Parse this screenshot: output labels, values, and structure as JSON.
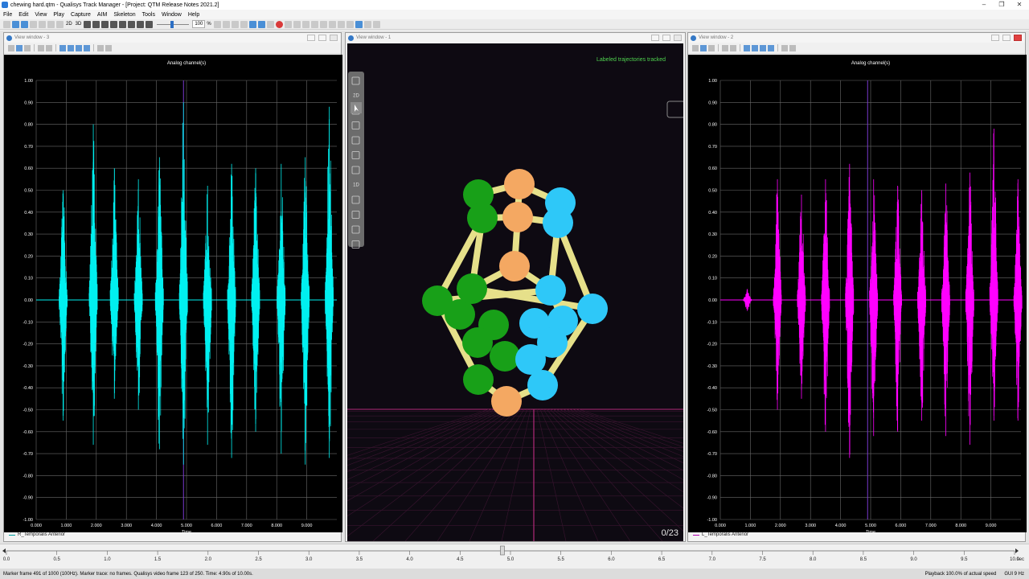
{
  "window": {
    "title": "chewing hard.qtm - Qualisys Track Manager - [Project: QTM Release Notes 2021.2]",
    "controls": [
      "–",
      "❐",
      "✕"
    ]
  },
  "menu": [
    "File",
    "Edit",
    "View",
    "Play",
    "Capture",
    "AIM",
    "Skeleton",
    "Tools",
    "Window",
    "Help"
  ],
  "toolbar": {
    "mode_2d": "2D",
    "mode_3d": "3D",
    "speed_value": "100",
    "speed_unit": "%"
  },
  "windows": {
    "left": {
      "title": "View window - 3",
      "plot_title": "Analog channel(s)",
      "xlabel": "Time",
      "legend": "R_Temporalis Anterior",
      "color": "#00f0f0"
    },
    "middle": {
      "title": "View window - 1",
      "status": "Labeled trajectories tracked",
      "counter": "0/23",
      "tools": [
        "2D",
        "1D"
      ]
    },
    "right": {
      "title": "View window - 2",
      "plot_title": "Analog channel(s)",
      "xlabel": "Time",
      "legend": "L_Temporalis Anterior",
      "color": "#ff00ff"
    }
  },
  "chart_data": [
    {
      "type": "line",
      "title": "Analog channel(s)",
      "xlabel": "Time",
      "ylabel": "",
      "xlim": [
        0,
        10
      ],
      "ylim": [
        -1,
        1
      ],
      "xticks": [
        "0.000",
        "1.000",
        "2.000",
        "3.000",
        "4.000",
        "5.000",
        "6.000",
        "7.000",
        "8.000",
        "9.000"
      ],
      "yticks": [
        "1.00",
        "0.90",
        "0.80",
        "0.70",
        "0.60",
        "0.50",
        "0.40",
        "0.30",
        "0.20",
        "0.10",
        "0.00",
        "-0.10",
        "-0.20",
        "-0.30",
        "-0.40",
        "-0.50",
        "-0.60",
        "-0.70",
        "-0.80",
        "-0.90",
        "-1.00"
      ],
      "grid": true,
      "series": [
        {
          "name": "R_Temporalis Anterior",
          "color": "#00f0f0",
          "bursts": [
            {
              "t": 0.9,
              "max": 0.5,
              "min": -0.55
            },
            {
              "t": 1.9,
              "max": 0.8,
              "min": -0.66
            },
            {
              "t": 2.6,
              "max": 0.6,
              "min": -0.45
            },
            {
              "t": 3.4,
              "max": 0.55,
              "min": -0.5
            },
            {
              "t": 4.1,
              "max": 0.65,
              "min": -0.68
            },
            {
              "t": 4.9,
              "max": 0.9,
              "min": -0.75
            },
            {
              "t": 5.7,
              "max": 0.52,
              "min": -0.66
            },
            {
              "t": 6.5,
              "max": 0.62,
              "min": -0.72
            },
            {
              "t": 7.3,
              "max": 0.6,
              "min": -0.6
            },
            {
              "t": 8.15,
              "max": 0.62,
              "min": -0.7
            },
            {
              "t": 8.95,
              "max": 0.65,
              "min": -0.75
            },
            {
              "t": 9.75,
              "max": 0.88,
              "min": -0.72
            }
          ]
        }
      ]
    },
    {
      "type": "line",
      "title": "Analog channel(s)",
      "xlabel": "Time",
      "ylabel": "",
      "xlim": [
        0,
        10
      ],
      "ylim": [
        -1,
        1
      ],
      "xticks": [
        "0.000",
        "1.000",
        "2.000",
        "3.000",
        "4.000",
        "5.000",
        "6.000",
        "7.000",
        "8.000",
        "9.000"
      ],
      "yticks": [
        "1.00",
        "0.90",
        "0.80",
        "0.70",
        "0.60",
        "0.50",
        "0.40",
        "0.30",
        "0.20",
        "0.10",
        "0.00",
        "-0.10",
        "-0.20",
        "-0.30",
        "-0.40",
        "-0.50",
        "-0.60",
        "-0.70",
        "-0.80",
        "-0.90",
        "-1.00"
      ],
      "grid": true,
      "series": [
        {
          "name": "L_Temporalis Anterior",
          "color": "#ff00ff",
          "bursts": [
            {
              "t": 0.9,
              "max": 0.05,
              "min": -0.05
            },
            {
              "t": 1.9,
              "max": 0.55,
              "min": -0.5
            },
            {
              "t": 2.7,
              "max": 0.48,
              "min": -0.45
            },
            {
              "t": 3.5,
              "max": 0.55,
              "min": -0.6
            },
            {
              "t": 4.3,
              "max": 0.62,
              "min": -0.72
            },
            {
              "t": 5.1,
              "max": 0.55,
              "min": -0.62
            },
            {
              "t": 5.9,
              "max": 0.52,
              "min": -0.6
            },
            {
              "t": 6.7,
              "max": 0.5,
              "min": -0.55
            },
            {
              "t": 7.5,
              "max": 0.53,
              "min": -0.62
            },
            {
              "t": 8.3,
              "max": 0.58,
              "min": -0.66
            },
            {
              "t": 9.1,
              "max": 0.78,
              "min": -0.55
            },
            {
              "t": 9.9,
              "max": 0.55,
              "min": -0.55
            }
          ]
        }
      ]
    }
  ],
  "timeline": {
    "ticks": [
      "0.0",
      "0.5",
      "1.0",
      "1.5",
      "2.0",
      "2.5",
      "3.0",
      "3.5",
      "4.0",
      "4.5",
      "5.0",
      "5.5",
      "6.0",
      "6.5",
      "7.0",
      "7.5",
      "8.0",
      "8.5",
      "9.0",
      "9.5",
      "10.0"
    ],
    "unit": "sec",
    "position": 0.49
  },
  "status": {
    "left": "Marker frame 491 of 1000 (100Hz). Marker trace: no frames. Qualisys video frame 123 of 250. Time: 4.90s of 10.00s.",
    "playback": "Playback 100.0% of actual speed",
    "gui": "GUI 9 Hz"
  },
  "colors": {
    "green_marker": "#18a018",
    "blue_marker": "#2ec8f8",
    "orange_marker": "#f4a862",
    "bone": "#e6e08a",
    "floor_grid": "#b02a78"
  }
}
